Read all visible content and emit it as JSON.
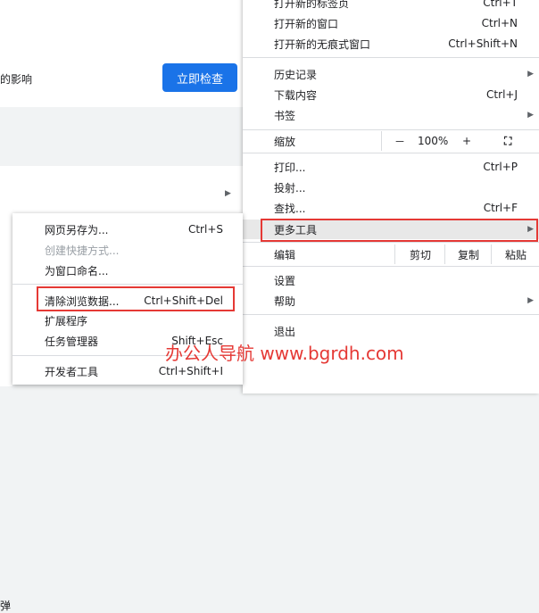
{
  "settings_page": {
    "safety_text": "的影响",
    "check_now_button": "立即检查",
    "partial_text": "弹"
  },
  "menu": {
    "new_tab": "打开新的标签页",
    "new_tab_sc": "Ctrl+T",
    "new_window": "打开新的窗口",
    "new_window_sc": "Ctrl+N",
    "incognito": "打开新的无痕式窗口",
    "incognito_sc": "Ctrl+Shift+N",
    "history": "历史记录",
    "downloads": "下载内容",
    "downloads_sc": "Ctrl+J",
    "bookmarks": "书签",
    "zoom_label": "缩放",
    "zoom_minus": "－",
    "zoom_value": "100%",
    "zoom_plus": "+",
    "print": "打印...",
    "print_sc": "Ctrl+P",
    "cast": "投射...",
    "find": "查找...",
    "find_sc": "Ctrl+F",
    "more_tools": "更多工具",
    "edit_label": "编辑",
    "cut": "剪切",
    "copy": "复制",
    "paste": "粘贴",
    "settings": "设置",
    "help": "帮助",
    "exit": "退出"
  },
  "submenu": {
    "save_page": "网页另存为...",
    "save_page_sc": "Ctrl+S",
    "create_shortcut": "创建快捷方式...",
    "name_window": "为窗口命名...",
    "clear_data": "清除浏览数据...",
    "clear_data_sc": "Ctrl+Shift+Del",
    "extensions": "扩展程序",
    "task_manager": "任务管理器",
    "task_manager_sc": "Shift+Esc",
    "devtools": "开发者工具",
    "devtools_sc": "Ctrl+Shift+I"
  },
  "watermark": "办公人导航 www.bgrdh.com",
  "colors": {
    "accent": "#1a73e8",
    "highlight_box": "#e53935"
  }
}
